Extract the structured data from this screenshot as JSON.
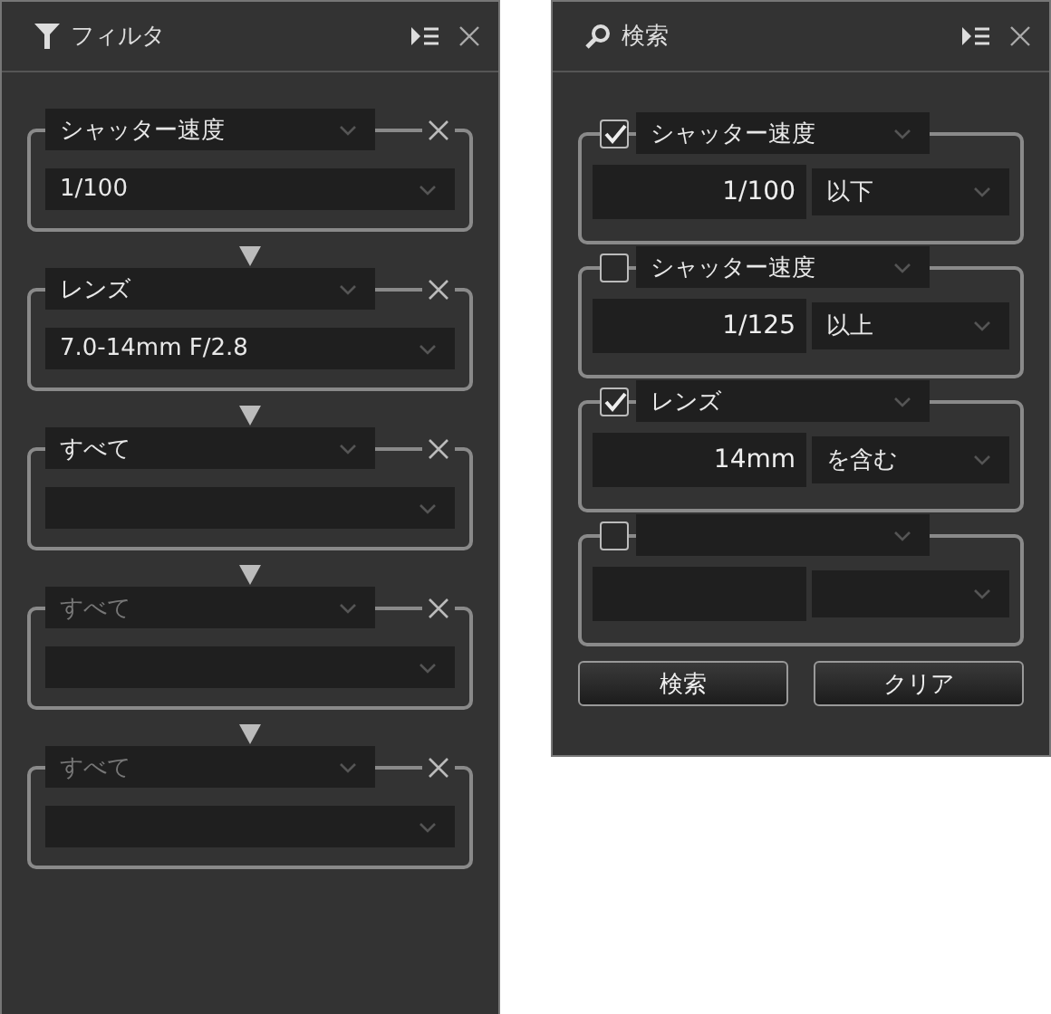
{
  "filter_panel": {
    "title": "フィルタ",
    "filters": [
      {
        "field": "シャッター速度",
        "value": "1/100",
        "disabled": false
      },
      {
        "field": "レンズ",
        "value": "7.0-14mm F/2.8",
        "disabled": false
      },
      {
        "field": "すべて",
        "disabled": false
      },
      {
        "field": "すべて",
        "disabled": true
      },
      {
        "field": "すべて",
        "disabled": true
      }
    ]
  },
  "search_panel": {
    "title": "検索",
    "conditions": [
      {
        "checked": true,
        "field": "シャッター速度",
        "value": "1/100",
        "operator": "以下"
      },
      {
        "checked": false,
        "field": "シャッター速度",
        "value": "1/125",
        "operator": "以上"
      },
      {
        "checked": true,
        "field": "レンズ",
        "value": "14mm",
        "operator": "を含む"
      },
      {
        "checked": false
      }
    ],
    "buttons": [
      "検索",
      "クリア"
    ]
  }
}
